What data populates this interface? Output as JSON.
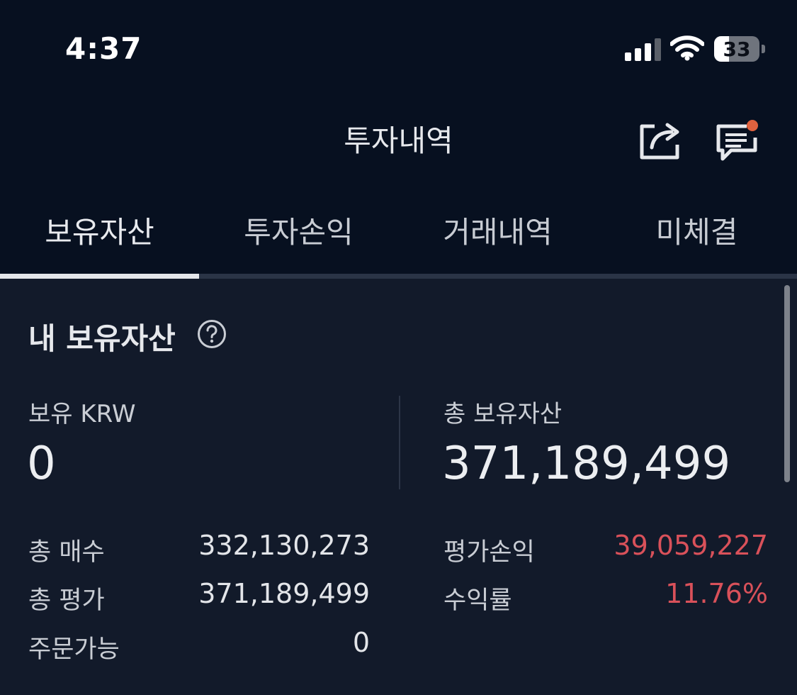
{
  "status_bar": {
    "time": "4:37",
    "battery": "33",
    "icons": [
      "cellular-signal-icon",
      "wifi-icon",
      "battery-icon"
    ]
  },
  "header": {
    "title": "투자내역",
    "icons": [
      "share-icon",
      "chat-notification-icon"
    ],
    "notification_dot_color": "#e0623f"
  },
  "tabs": [
    {
      "label": "보유자산",
      "active": true
    },
    {
      "label": "투자손익",
      "active": false
    },
    {
      "label": "거래내역",
      "active": false
    },
    {
      "label": "미체결",
      "active": false
    }
  ],
  "section": {
    "title": "내 보유자산",
    "help_icon": "question-circle-icon"
  },
  "summary": {
    "krw_label": "보유 KRW",
    "krw_value": "0",
    "total_label": "총 보유자산",
    "total_value": "371,189,499"
  },
  "details_left": [
    {
      "label": "총 매수",
      "value": "332,130,273"
    },
    {
      "label": "총 평가",
      "value": "371,189,499"
    },
    {
      "label": "주문가능",
      "value": "0"
    }
  ],
  "details_right": [
    {
      "label": "평가손익",
      "value": "39,059,227"
    },
    {
      "label": "수익률",
      "value": "11.76%"
    }
  ],
  "colors": {
    "background_top": "#071020",
    "background_content": "#121a2a",
    "profit_red": "#d9515a"
  }
}
